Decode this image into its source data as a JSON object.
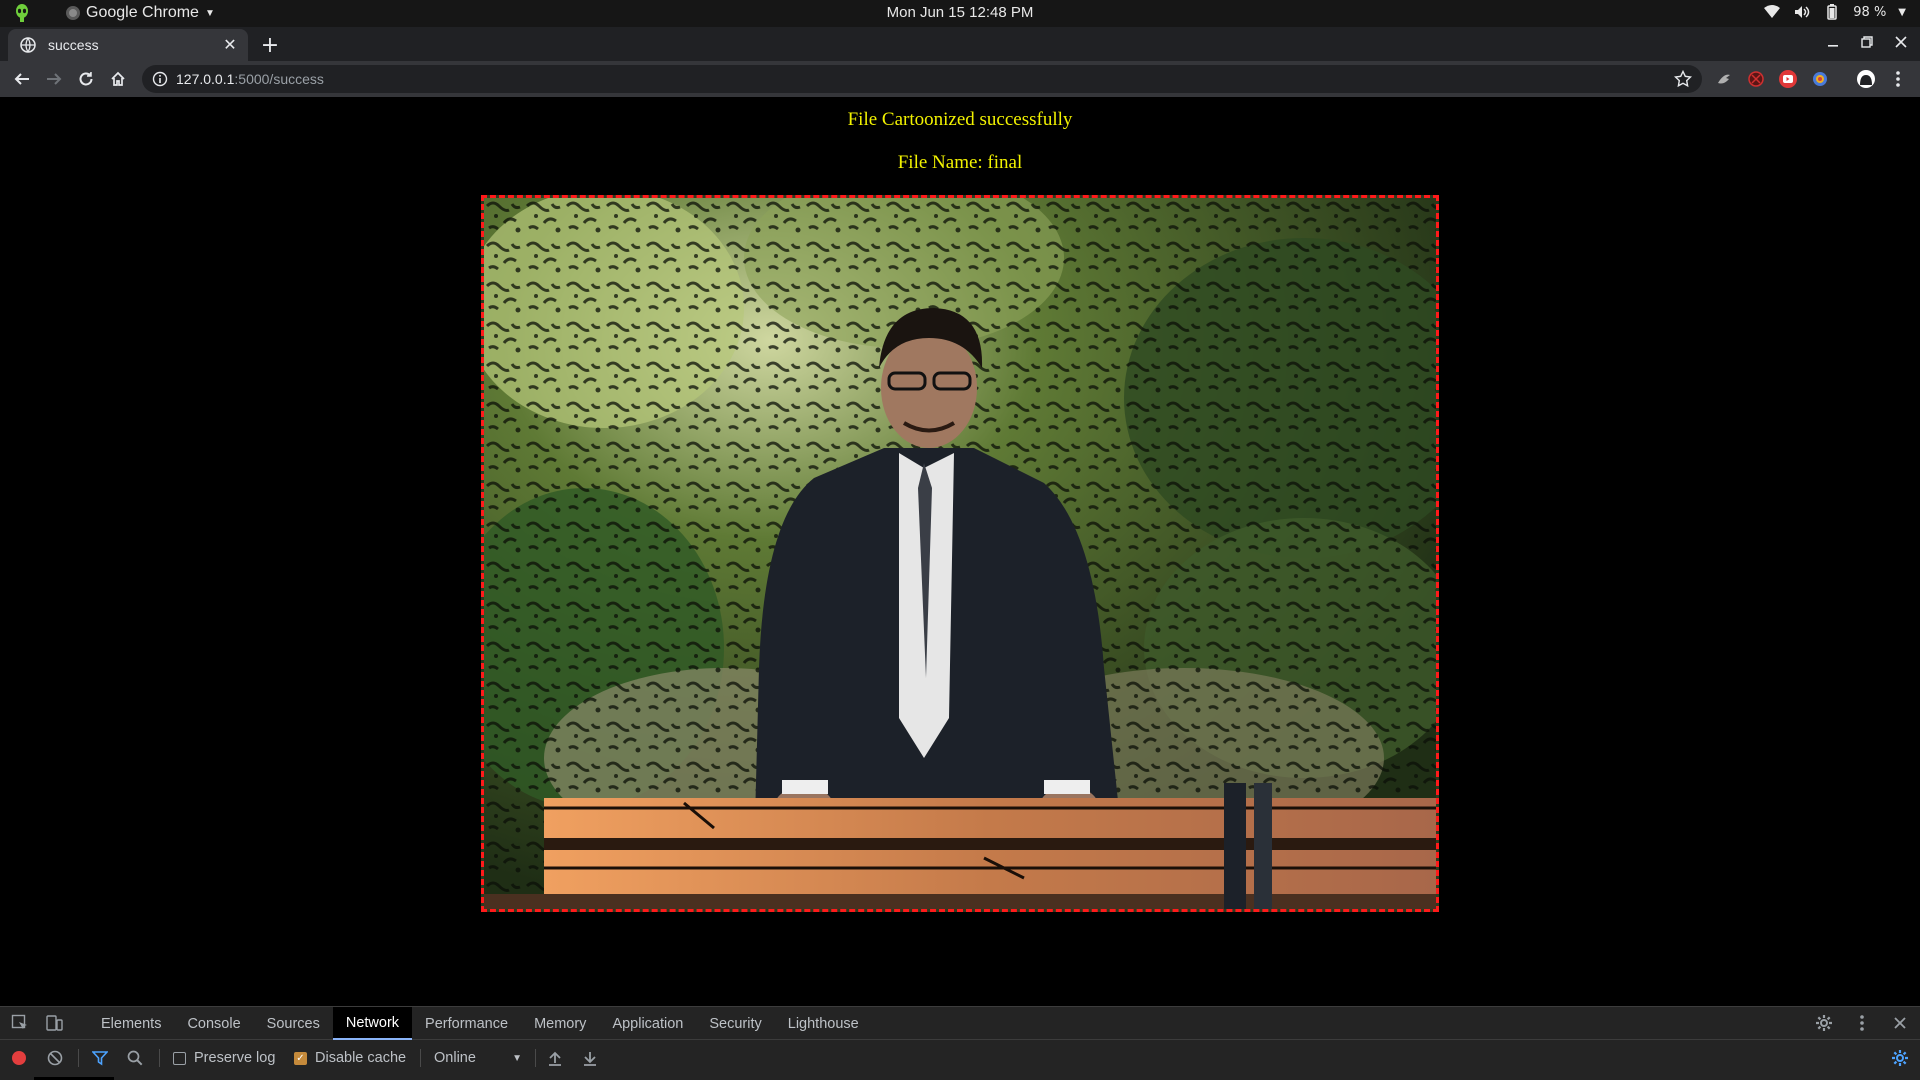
{
  "os_bar": {
    "app_name": "Google Chrome",
    "clock": "Mon Jun 15  12:48 PM",
    "battery": "98 %"
  },
  "browser": {
    "tab_title": "success",
    "url_host": "127.0.0.1",
    "url_path": ":5000/success"
  },
  "page": {
    "message": "File Cartoonized successfully",
    "file_label": "File Name: final",
    "image_alt": "cartoonized photo",
    "border_color": "#ff1a1a",
    "text_color": "#f2f200"
  },
  "devtools": {
    "tabs": [
      {
        "label": "Elements",
        "active": false
      },
      {
        "label": "Console",
        "active": false
      },
      {
        "label": "Sources",
        "active": false
      },
      {
        "label": "Network",
        "active": true
      },
      {
        "label": "Performance",
        "active": false
      },
      {
        "label": "Memory",
        "active": false
      },
      {
        "label": "Application",
        "active": false
      },
      {
        "label": "Security",
        "active": false
      },
      {
        "label": "Lighthouse",
        "active": false
      }
    ],
    "preserve_log_label": "Preserve log",
    "preserve_log_checked": false,
    "disable_cache_label": "Disable cache",
    "disable_cache_checked": true,
    "throttling_value": "Online"
  },
  "icons": {
    "activities": "alien-icon",
    "accent": "#8ab4f8"
  }
}
